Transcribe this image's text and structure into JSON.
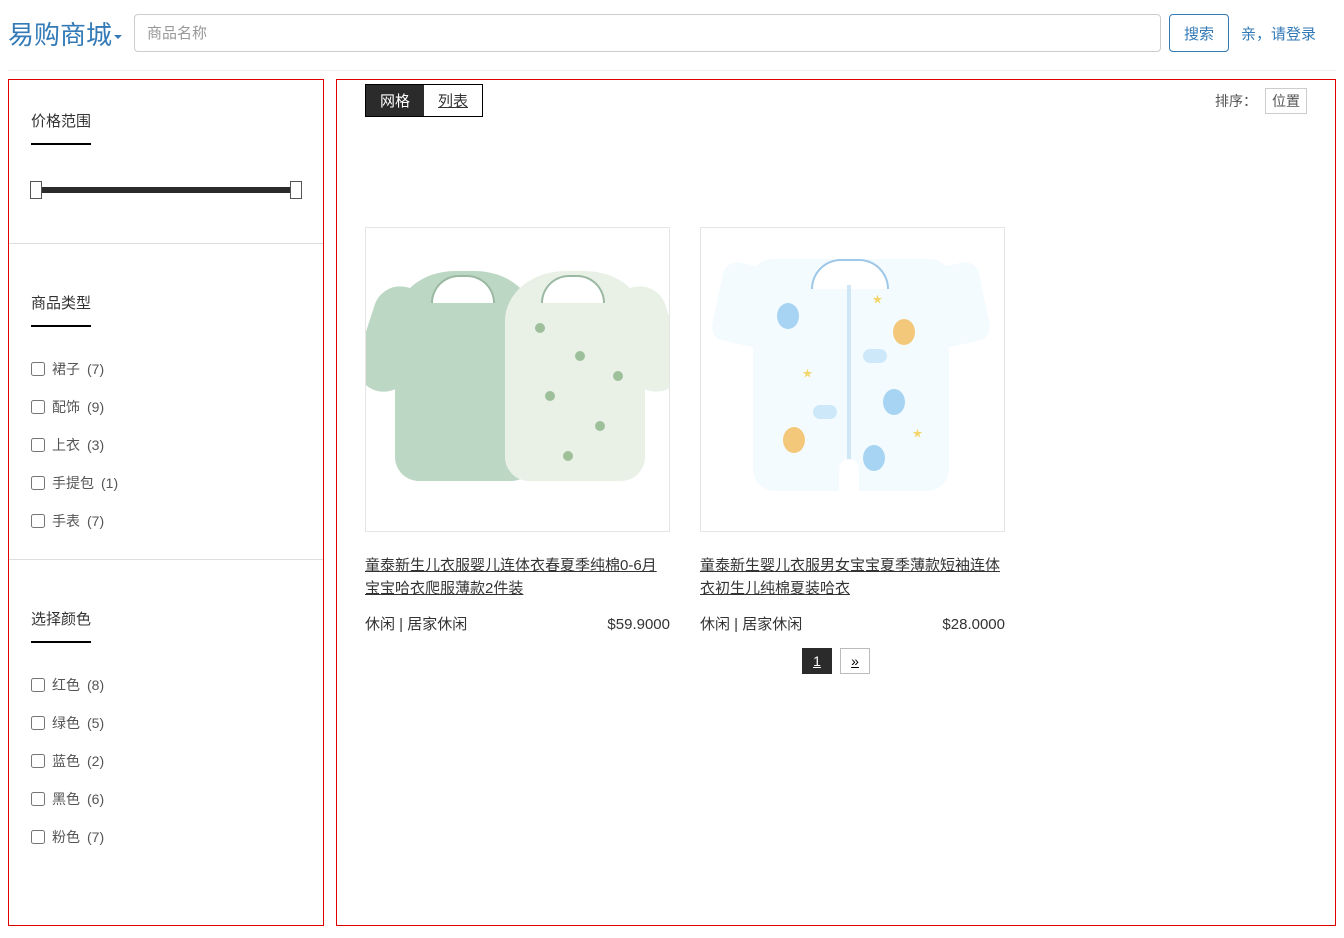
{
  "header": {
    "logo": "易购商城",
    "search_placeholder": "商品名称",
    "search_button": "搜索",
    "login_text": "亲，请登录"
  },
  "sidebar": {
    "price_title": "价格范围",
    "type_title": "商品类型",
    "color_title": "选择颜色",
    "types": [
      {
        "label": "裙子",
        "count": "(7)"
      },
      {
        "label": "配饰",
        "count": "(9)"
      },
      {
        "label": "上衣",
        "count": "(3)"
      },
      {
        "label": "手提包",
        "count": "(1)"
      },
      {
        "label": "手表",
        "count": "(7)"
      }
    ],
    "colors": [
      {
        "label": "红色",
        "count": "(8)"
      },
      {
        "label": "绿色",
        "count": "(5)"
      },
      {
        "label": "蓝色",
        "count": "(2)"
      },
      {
        "label": "黑色",
        "count": "(6)"
      },
      {
        "label": "粉色",
        "count": "(7)"
      }
    ]
  },
  "toolbar": {
    "grid_label": "网格",
    "list_label": "列表",
    "sort_label": "排序：",
    "sort_value": "位置"
  },
  "products": [
    {
      "title": "童泰新生儿衣服婴儿连体衣春夏季纯棉0-6月宝宝哈衣爬服薄款2件装",
      "category": "休闲 | 居家休闲",
      "price": "$59.9000"
    },
    {
      "title": "童泰新生婴儿衣服男女宝宝夏季薄款短袖连体衣初生儿纯棉夏装哈衣",
      "category": "休闲 | 居家休闲",
      "price": "$28.0000"
    }
  ],
  "pagination": {
    "current": "1",
    "next": "»"
  }
}
